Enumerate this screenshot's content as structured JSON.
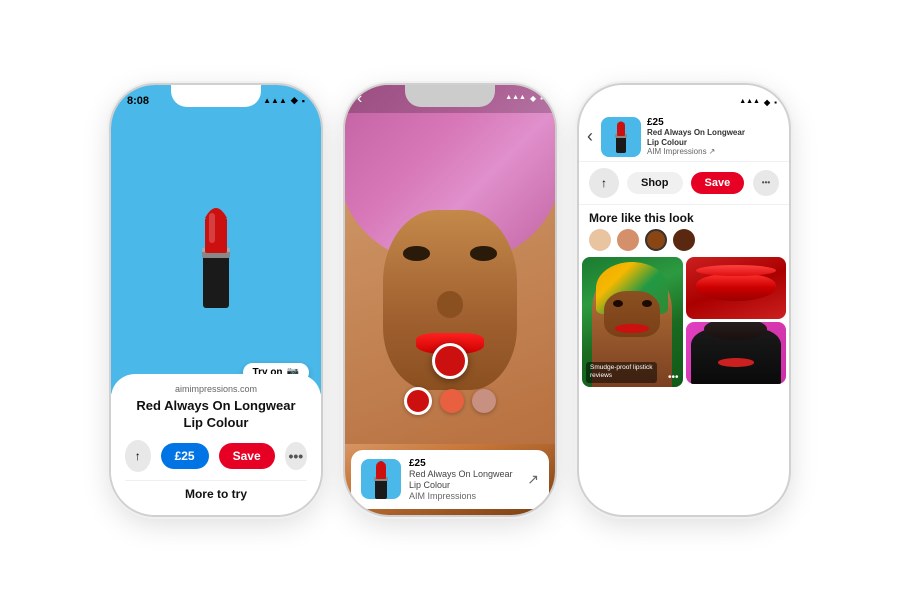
{
  "phones": {
    "left": {
      "time": "8:08",
      "status_icons": "▲ ◆ ▪",
      "source_url": "aimimpressions.com",
      "product_title": "Red Always On Longwear\nLip Colour",
      "try_on_label": "Try on",
      "price_label": "£25",
      "save_label": "Save",
      "more_to_try": "More to try",
      "background_color": "#4ab8e8"
    },
    "middle": {
      "price_label": "£25",
      "product_title": "Red Always On Longwear\nLip Colour",
      "brand_label": "AIM Impressions",
      "colors": [
        "#cc1010",
        "#e86040",
        "#c89080"
      ]
    },
    "right": {
      "back_icon": "‹",
      "price_label": "£25",
      "product_title": "Red Always On Longwear Lip Colour",
      "brand_label": "AIM Impressions",
      "external_icon": "↗",
      "share_icon": "↑",
      "shop_label": "Shop",
      "save_label": "Save",
      "more_icon": "•••",
      "section_title": "More like this look",
      "rec_label": "Smudge-proof lipstick\nreviews",
      "swatches": [
        "beige",
        "peach",
        "brown",
        "dark"
      ]
    }
  }
}
